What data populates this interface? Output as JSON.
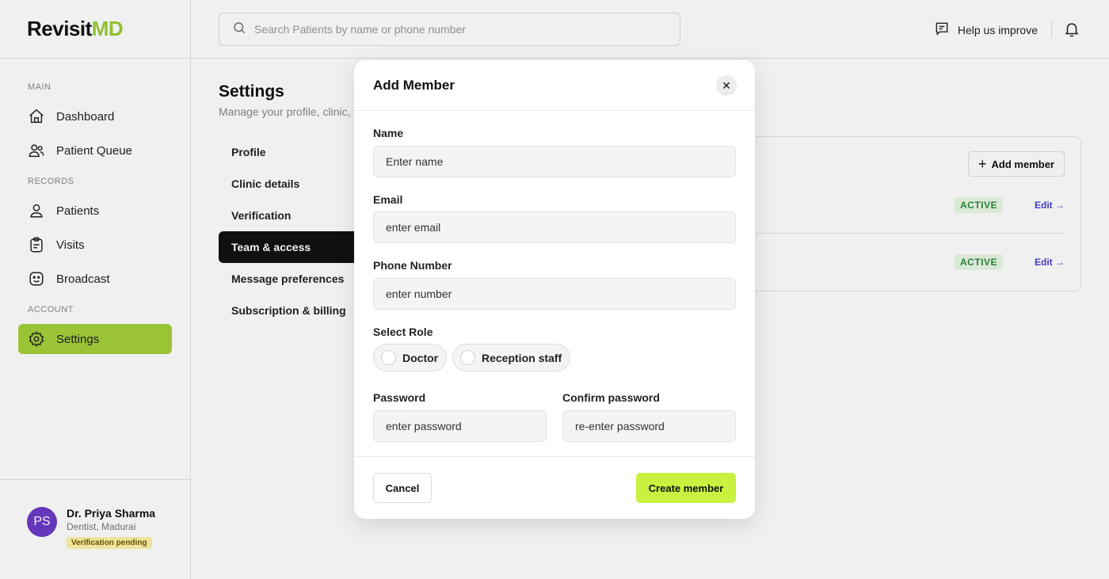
{
  "app": {
    "logo_text_main": "Revisit",
    "logo_text_accent": "MD"
  },
  "sidebar": {
    "sections": [
      {
        "label": "MAIN"
      },
      {
        "label": "RECORDS"
      },
      {
        "label": "ACCOUNT"
      }
    ],
    "items": [
      {
        "label": "Dashboard",
        "icon": "home-icon"
      },
      {
        "label": "Patient Queue",
        "icon": "users-icon"
      },
      {
        "label": "Patients",
        "icon": "user-icon"
      },
      {
        "label": "Visits",
        "icon": "clipboard-icon"
      },
      {
        "label": "Broadcast",
        "icon": "smile-icon"
      },
      {
        "label": "Settings",
        "icon": "gear-icon",
        "active": true
      }
    ],
    "user": {
      "initials": "PS",
      "name": "Dr. Priya Sharma",
      "subtitle": "Dentist, Madurai",
      "badge": "Verification pending"
    }
  },
  "header": {
    "search_placeholder": "Search Patients by name or phone number",
    "help_label": "Help us improve"
  },
  "main": {
    "title": "Settings",
    "subtitle": "Manage your profile, clinic,",
    "tabs": [
      {
        "label": "Profile"
      },
      {
        "label": "Clinic details"
      },
      {
        "label": "Verification"
      },
      {
        "label": "Team & access",
        "active": true
      },
      {
        "label": "Message preferences"
      },
      {
        "label": "Subscription & billing"
      }
    ],
    "team": {
      "add_member_label": "Add member",
      "rows": [
        {
          "status": "ACTIVE",
          "edit": "Edit →"
        },
        {
          "status": "ACTIVE",
          "edit": "Edit →"
        }
      ]
    }
  },
  "modal": {
    "title": "Add Member",
    "name_label": "Name",
    "name_placeholder": "Enter name",
    "email_label": "Email",
    "email_placeholder": "enter email",
    "phone_label": "Phone Number",
    "phone_placeholder": "enter number",
    "role_label": "Select Role",
    "roles": [
      {
        "label": "Doctor"
      },
      {
        "label": "Reception staff"
      }
    ],
    "password_label": "Password",
    "password_placeholder": "enter password",
    "confirm_label": "Confirm password",
    "confirm_placeholder": "re-enter password",
    "cancel_label": "Cancel",
    "create_label": "Create member"
  },
  "colors": {
    "accent": "#a4d13a",
    "create_button": "#c8f23f",
    "avatar": "#6c3bc6",
    "active_badge_text": "#2f8a3c",
    "edit_link": "#4a3ed6"
  }
}
